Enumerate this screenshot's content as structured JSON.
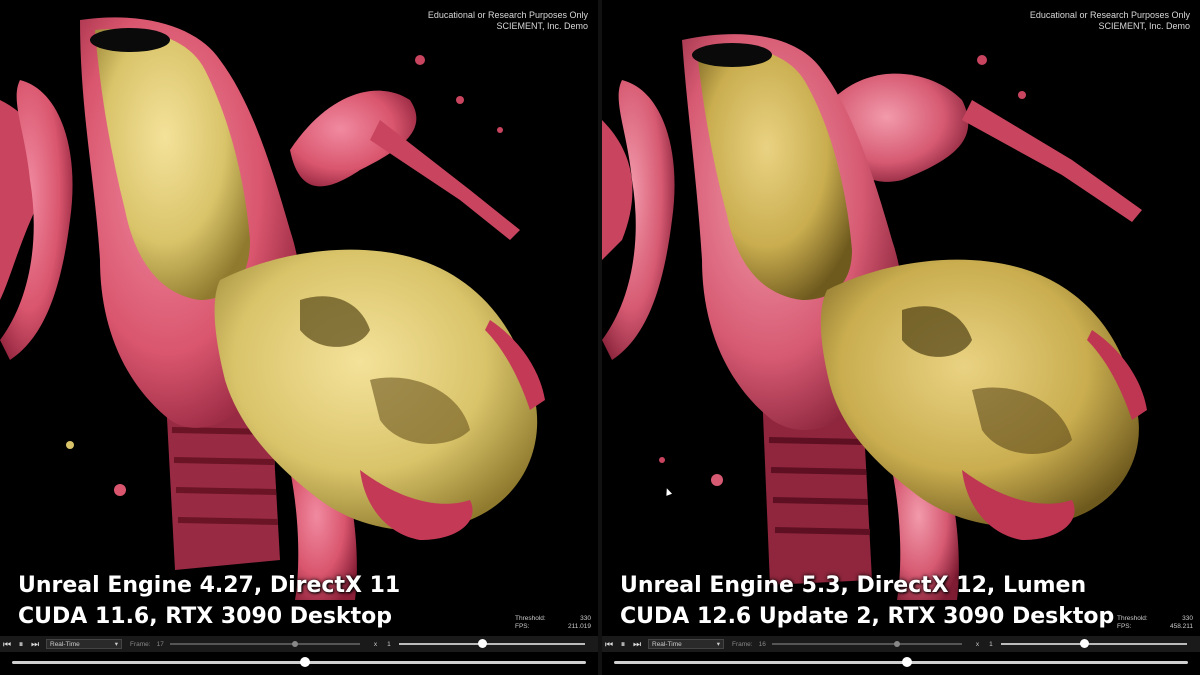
{
  "colors": {
    "background": "#000000",
    "tissue_red": "#d9566e",
    "tissue_gold": "#d9c46a",
    "control_bar": "#1a1a1a"
  },
  "panels": [
    {
      "watermark": [
        "Educational or Research Purposes Only",
        "SCIEMENT, Inc. Demo"
      ],
      "caption": [
        "Unreal Engine 4.27, DirectX 11",
        "CUDA 11.6, RTX 3090 Desktop"
      ],
      "stats": {
        "threshold_label": "Threshold:",
        "threshold_value": "330",
        "fps_label": "FPS:",
        "fps_value": "211.019"
      },
      "controls": {
        "mode": "Real-Time",
        "frame_label": "Frame:",
        "frame_value": "17",
        "speed_label": "x",
        "speed_value": "1",
        "frame_position": 0.66,
        "speed_position": 0.45
      },
      "timeline_position": 0.51
    },
    {
      "watermark": [
        "Educational or Research Purposes Only",
        "SCIEMENT, Inc. Demo"
      ],
      "caption": [
        "Unreal Engine 5.3, DirectX 12, Lumen",
        "CUDA 12.6 Update 2, RTX 3090 Desktop"
      ],
      "stats": {
        "threshold_label": "Threshold:",
        "threshold_value": "330",
        "fps_label": "FPS:",
        "fps_value": "458.211"
      },
      "controls": {
        "mode": "Real-Time",
        "frame_label": "Frame:",
        "frame_value": "16",
        "speed_label": "x",
        "speed_value": "1",
        "frame_position": 0.66,
        "speed_position": 0.45
      },
      "timeline_position": 0.51
    }
  ]
}
